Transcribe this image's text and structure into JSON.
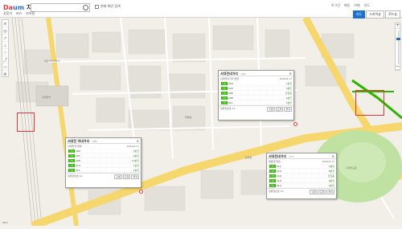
{
  "header": {
    "logo_part1": "Da",
    "logo_part2": "um",
    "logo_part3": "지도",
    "search_value": "",
    "checkbox_label": "현재 화면 검색",
    "links": [
      "로그인",
      "메일",
      "카페",
      "지도"
    ]
  },
  "subbar": {
    "items": [
      "길찾기",
      "버스",
      "지하철"
    ]
  },
  "map_types": [
    "지도",
    "스카이뷰",
    "로드뷰"
  ],
  "active_map_type": "지도",
  "sidebar_icons": [
    "layers-icon",
    "location-icon",
    "route-icon",
    "measure-icon",
    "bookmark-icon",
    "share-icon",
    "print-icon",
    "settings-icon"
  ],
  "zoom": {
    "plus": "+",
    "minus": "−"
  },
  "popups": [
    {
      "title": "서대전네거리",
      "id": "(39)",
      "subtitle": "서대전네거리 방면",
      "updated": "2019.6.17",
      "rows": [
        {
          "route": "103",
          "eta": "7분전"
        },
        {
          "route": "104",
          "eta": "3분전"
        },
        {
          "route": "105",
          "eta": "진입중"
        },
        {
          "route": "106",
          "eta": "2분전"
        },
        {
          "route": "311",
          "eta": "5분전"
        }
      ],
      "footer": "정류장번호 11",
      "buttons": [
        "출발",
        "도착",
        "즐겨"
      ]
    },
    {
      "title": "서대전 역네거리",
      "id": "(38)",
      "subtitle": "서대전역 방면",
      "updated": "2019.6.17",
      "rows": [
        {
          "route": "102",
          "eta": "3분전"
        },
        {
          "route": "107",
          "eta": "6분전"
        },
        {
          "route": "108",
          "eta": "10분전"
        },
        {
          "route": "113",
          "eta": "1분전"
        },
        {
          "route": "211",
          "eta": "2분전"
        }
      ],
      "footer": "정류장번호 12",
      "buttons": [
        "출발",
        "도착",
        "즐겨"
      ]
    },
    {
      "title": "서대전네거리",
      "id": "(37)",
      "subtitle": "목원대 방면",
      "updated": "2019.6.17",
      "rows": [
        {
          "route": "111",
          "eta": "4분전"
        },
        {
          "route": "112",
          "eta": "8분전"
        },
        {
          "route": "114",
          "eta": "진입중"
        },
        {
          "route": "119",
          "eta": "6분전"
        },
        {
          "route": "312",
          "eta": "9분전"
        }
      ],
      "footer": "정류장번호 13",
      "buttons": [
        "출발",
        "도착",
        "즐겨"
      ]
    }
  ],
  "map_labels": [
    "서대전역",
    "서대전공원",
    "대전서부경찰서",
    "태평동",
    "문화동"
  ],
  "scale_text": "50m",
  "colors": {
    "accent": "#1f6fd1",
    "bus_green": "#2db400",
    "pin_red": "#e4393c",
    "road_yellow": "#f5d76e"
  }
}
